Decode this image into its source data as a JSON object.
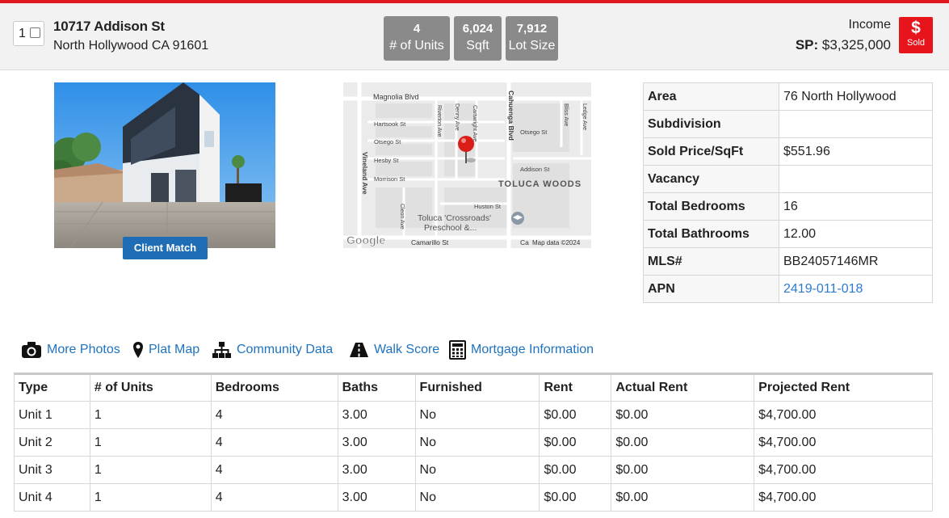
{
  "listing": {
    "index": "1",
    "address_line1": "10717 Addison St",
    "address_line2": "North Hollywood CA 91601",
    "stats": [
      {
        "value": "4",
        "label": "# of Units"
      },
      {
        "value": "6,024",
        "label": "Sqft"
      },
      {
        "value": "7,912",
        "label": "Lot Size"
      }
    ],
    "type": "Income",
    "sp_label": "SP:",
    "sp_value": "$3,325,000",
    "status_symbol": "$",
    "status_label": "Sold",
    "accent_color": "#e0191f"
  },
  "photo": {
    "client_match_label": "Client Match"
  },
  "map": {
    "streets": [
      "Magnolia Blvd",
      "Hartsook St",
      "Otsego St",
      "Hesby St",
      "Morrison St",
      "Vineland Ave",
      "Riverton Ave",
      "Denny Ave",
      "Cartwright Ave",
      "Cahuenga Blvd",
      "Otsego St",
      "Bliss Ave",
      "Ledge Ave",
      "Addison St",
      "Huston St",
      "Cleon Ave",
      "Camarillo St",
      "Ca"
    ],
    "neighborhood": "TOLUCA WOODS",
    "poi_line1": "Toluca 'Crossroads'",
    "poi_line2": "Preschool &...",
    "logo": "Google",
    "attribution": "Map data ©2024"
  },
  "details": [
    {
      "label": "Area",
      "value": "76 North Hollywood"
    },
    {
      "label": "Subdivision",
      "value": ""
    },
    {
      "label": "Sold Price/SqFt",
      "value": "$551.96"
    },
    {
      "label": "Vacancy",
      "value": ""
    },
    {
      "label": "Total Bedrooms",
      "value": "16"
    },
    {
      "label": "Total Bathrooms",
      "value": "12.00"
    },
    {
      "label": "MLS#",
      "value": "BB24057146MR"
    },
    {
      "label": "APN",
      "value": "2419-011-018"
    }
  ],
  "links": [
    {
      "label": "More Photos",
      "icon": "camera-icon"
    },
    {
      "label": "Plat Map",
      "icon": "map-pin-icon"
    },
    {
      "label": "Community Data",
      "icon": "sitemap-icon"
    },
    {
      "label": "Walk Score",
      "icon": "road-icon"
    },
    {
      "label": "Mortgage Information",
      "icon": "calculator-icon"
    }
  ],
  "units_table": {
    "headers": [
      "Type",
      "# of Units",
      "Bedrooms",
      "Baths",
      "Furnished",
      "Rent",
      "Actual Rent",
      "Projected Rent"
    ],
    "rows": [
      [
        "Unit 1",
        "1",
        "4",
        "3.00",
        "No",
        "$0.00",
        "$0.00",
        "$4,700.00"
      ],
      [
        "Unit 2",
        "1",
        "4",
        "3.00",
        "No",
        "$0.00",
        "$0.00",
        "$4,700.00"
      ],
      [
        "Unit 3",
        "1",
        "4",
        "3.00",
        "No",
        "$0.00",
        "$0.00",
        "$4,700.00"
      ],
      [
        "Unit 4",
        "1",
        "4",
        "3.00",
        "No",
        "$0.00",
        "$0.00",
        "$4,700.00"
      ]
    ]
  }
}
